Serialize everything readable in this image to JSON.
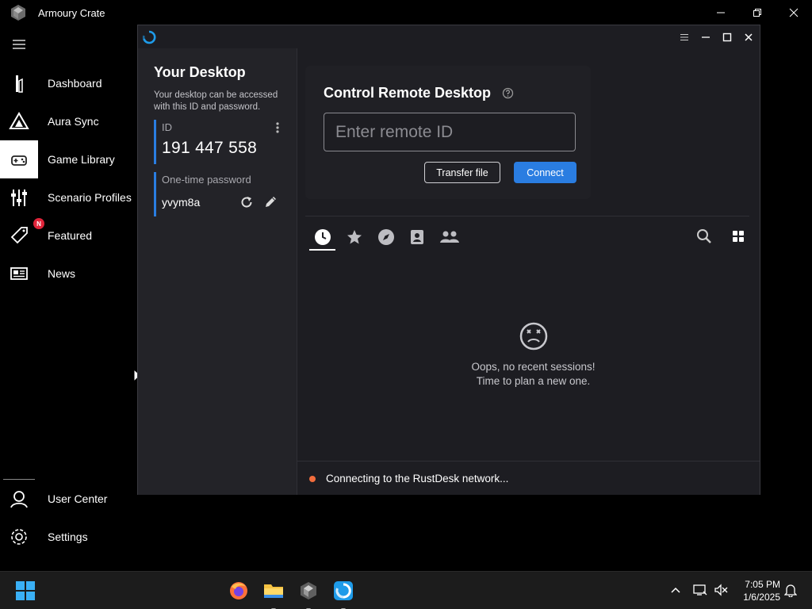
{
  "armoury": {
    "title": "Armoury Crate",
    "nav": [
      {
        "label": "Dashboard",
        "icon": "dashboard-icon"
      },
      {
        "label": "Aura Sync",
        "icon": "aura-sync-icon"
      },
      {
        "label": "Game Library",
        "icon": "game-library-icon",
        "active": true
      },
      {
        "label": "Scenario Profiles",
        "icon": "sliders-icon"
      },
      {
        "label": "Featured",
        "icon": "tag-icon",
        "badge": "N"
      },
      {
        "label": "News",
        "icon": "news-icon"
      }
    ],
    "bottom_nav": [
      {
        "label": "User Center",
        "icon": "user-center-icon"
      },
      {
        "label": "Settings",
        "icon": "gear-icon"
      }
    ]
  },
  "rustdesk": {
    "left": {
      "title": "Your Desktop",
      "description": "Your desktop can be accessed with this ID and password.",
      "id_label": "ID",
      "id_value": "191 447 558",
      "password_label": "One-time password",
      "password_value": "yvym8a"
    },
    "control": {
      "title": "Control Remote Desktop",
      "input_placeholder": "Enter remote ID",
      "input_value": "",
      "transfer_label": "Transfer file",
      "connect_label": "Connect"
    },
    "tabs": [
      "recent-sessions",
      "favorites",
      "discovered",
      "address-book",
      "group"
    ],
    "active_tab": "recent-sessions",
    "empty": {
      "line1": "Oops, no recent sessions!",
      "line2": "Time to plan a new one."
    },
    "status": "Connecting to the RustDesk network...",
    "colors": {
      "accent": "#2a7de1",
      "status_dot": "#f26d3d"
    }
  },
  "taskbar": {
    "time": "7:05 PM",
    "date": "1/6/2025",
    "apps": [
      "firefox-icon",
      "file-explorer-icon",
      "armoury-crate-icon",
      "rustdesk-icon"
    ]
  }
}
